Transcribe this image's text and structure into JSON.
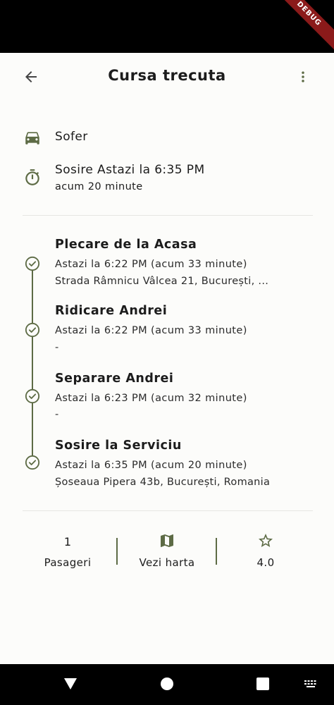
{
  "debug_banner": "DEBUG",
  "header": {
    "title": "Cursa trecuta",
    "back_icon": "arrow-left-icon",
    "menu_icon": "more-vert-icon"
  },
  "driver": {
    "icon": "car-icon",
    "label": "Sofer"
  },
  "arrival": {
    "icon": "timer-icon",
    "label": "Sosire Astazi la 6:35 PM",
    "relative": "acum 20 minute"
  },
  "stops": [
    {
      "title": "Plecare de la Acasa",
      "time": "Astazi la 6:22 PM (acum 33 minute)",
      "address": "Strada Râmnicu Vâlcea 21, București, ..."
    },
    {
      "title": "Ridicare Andrei",
      "time": "Astazi la 6:22 PM (acum 33 minute)",
      "address": "-"
    },
    {
      "title": "Separare Andrei",
      "time": "Astazi la 6:23 PM (acum 32 minute)",
      "address": "-"
    },
    {
      "title": "Sosire la Serviciu",
      "time": "Astazi la 6:35 PM (acum 20 minute)",
      "address": "Șoseaua Pipera 43b, București, Romania"
    }
  ],
  "footer": {
    "passengers_count": "1",
    "passengers_label": "Pasageri",
    "map_icon": "map-icon",
    "map_label": "Vezi harta",
    "rating_icon": "star-icon",
    "rating_value": "4.0"
  },
  "colors": {
    "accent": "#5d6b45",
    "background": "#fcfcfa",
    "text": "#1c1c1c"
  }
}
